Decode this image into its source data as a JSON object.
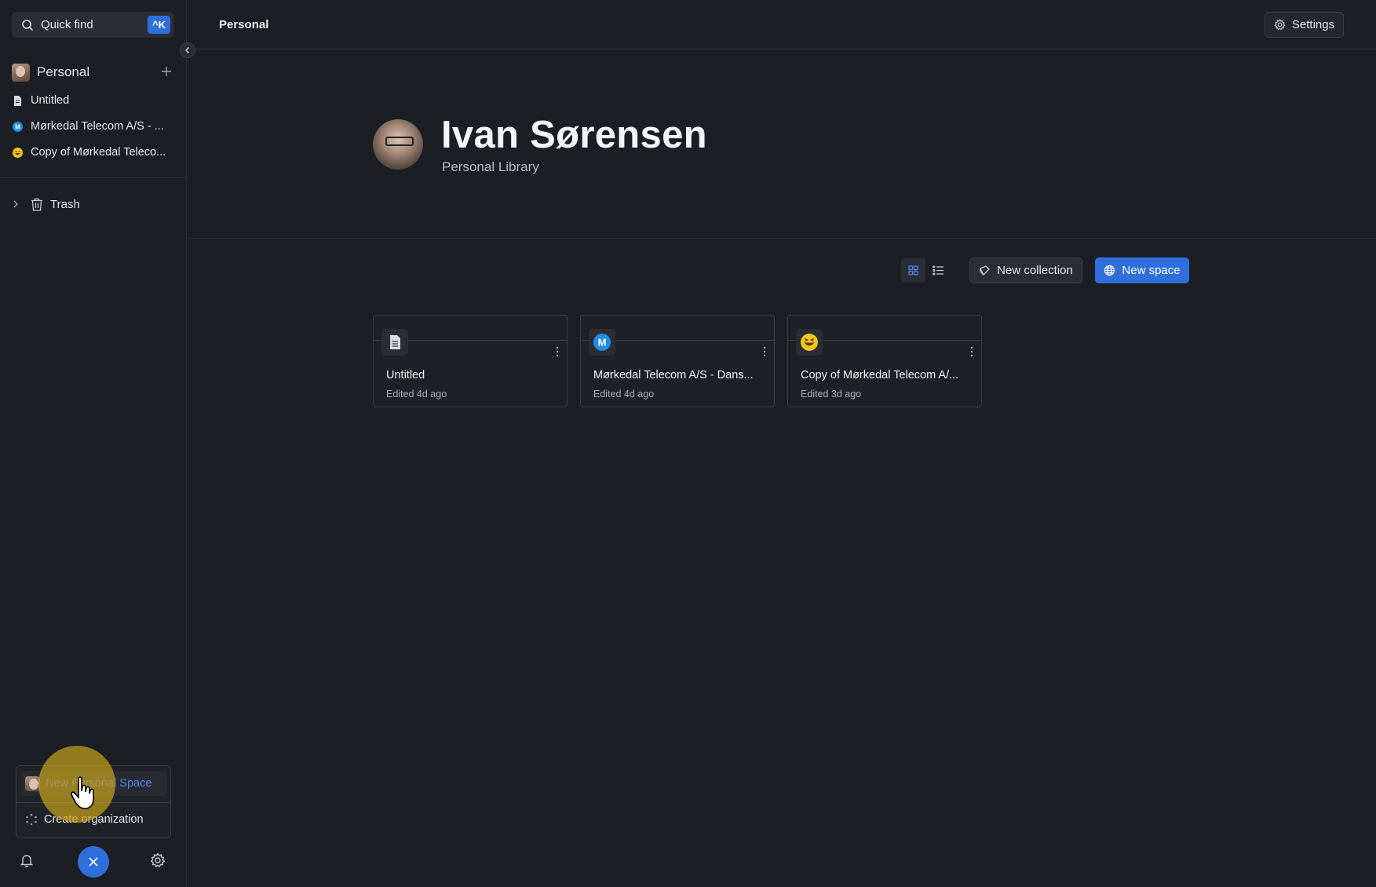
{
  "sidebar": {
    "quick_find": {
      "label": "Quick find",
      "shortcut": "^K"
    },
    "section": {
      "label": "Personal"
    },
    "items": [
      {
        "label": "Untitled",
        "icon": "document-icon"
      },
      {
        "label": "Mørkedal Telecom A/S - ...",
        "icon": "m-badge-icon"
      },
      {
        "label": "Copy of Mørkedal Teleco...",
        "icon": "laughing-emoji-icon"
      }
    ],
    "trash": {
      "label": "Trash"
    }
  },
  "popup_menu": {
    "items": [
      {
        "label": "New Personal Space"
      },
      {
        "label": "Create organization"
      }
    ]
  },
  "header": {
    "breadcrumb": "Personal",
    "settings_label": "Settings"
  },
  "profile": {
    "name": "Ivan Sørensen",
    "subtitle": "Personal Library"
  },
  "toolbar": {
    "new_collection_label": "New collection",
    "new_space_label": "New space"
  },
  "cards": [
    {
      "title": "Untitled",
      "meta": "Edited 4d ago",
      "icon": "document-icon"
    },
    {
      "title": "Mørkedal Telecom A/S - Dans...",
      "meta": "Edited 4d ago",
      "icon": "m-badge-icon"
    },
    {
      "title": "Copy of Mørkedal Telecom A/...",
      "meta": "Edited 3d ago",
      "icon": "laughing-emoji-icon"
    }
  ],
  "colors": {
    "accent": "#2f6fdd",
    "background": "#1b1e22",
    "highlight": "#c4a01e"
  }
}
